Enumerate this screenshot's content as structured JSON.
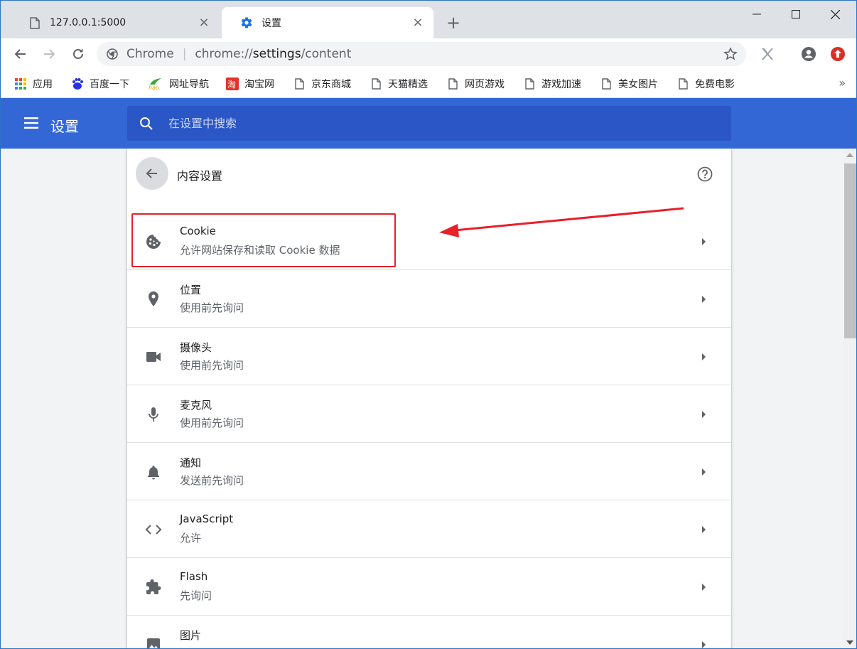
{
  "tabs": [
    {
      "title": "127.0.0.1:5000",
      "close": "×",
      "icon": "page-icon"
    },
    {
      "title": "设置",
      "close": "×",
      "icon": "gear-icon"
    }
  ],
  "new_tab": "+",
  "omnibox": {
    "chrome_label": "Chrome",
    "separator": "|",
    "url_prefix": "chrome://",
    "url_host": "settings",
    "url_path": "/content"
  },
  "bookmarks": [
    {
      "label": "应用",
      "icon": "apps-grid-icon"
    },
    {
      "label": "百度一下",
      "icon": "baidu-icon"
    },
    {
      "label": "网址导航",
      "icon": "hao123-icon"
    },
    {
      "label": "淘宝网",
      "icon": "taobao-icon"
    },
    {
      "label": "京东商城",
      "icon": "page-icon"
    },
    {
      "label": "天猫精选",
      "icon": "page-icon"
    },
    {
      "label": "网页游戏",
      "icon": "page-icon"
    },
    {
      "label": "游戏加速",
      "icon": "page-icon"
    },
    {
      "label": "美女图片",
      "icon": "page-icon"
    },
    {
      "label": "免费电影",
      "icon": "page-icon"
    }
  ],
  "bookmarks_more": "»",
  "settings_header": {
    "title": "设置",
    "search_placeholder": "在设置中搜索"
  },
  "content_settings": {
    "title": "内容设置",
    "rows": [
      {
        "title": "Cookie",
        "subtitle": "允许网站保存和读取 Cookie 数据",
        "icon": "cookie-icon"
      },
      {
        "title": "位置",
        "subtitle": "使用前先询问",
        "icon": "location-pin-icon"
      },
      {
        "title": "摄像头",
        "subtitle": "使用前先询问",
        "icon": "camera-icon"
      },
      {
        "title": "麦克风",
        "subtitle": "使用前先询问",
        "icon": "microphone-icon"
      },
      {
        "title": "通知",
        "subtitle": "发送前先询问",
        "icon": "bell-icon"
      },
      {
        "title": "JavaScript",
        "subtitle": "允许",
        "icon": "code-icon"
      },
      {
        "title": "Flash",
        "subtitle": "先询问",
        "icon": "puzzle-icon"
      },
      {
        "title": "图片",
        "subtitle": "",
        "icon": "image-icon"
      }
    ]
  },
  "colors": {
    "header_blue": "#3367d6",
    "search_blue": "#2a56c6",
    "annotation_red": "#e8202a"
  }
}
